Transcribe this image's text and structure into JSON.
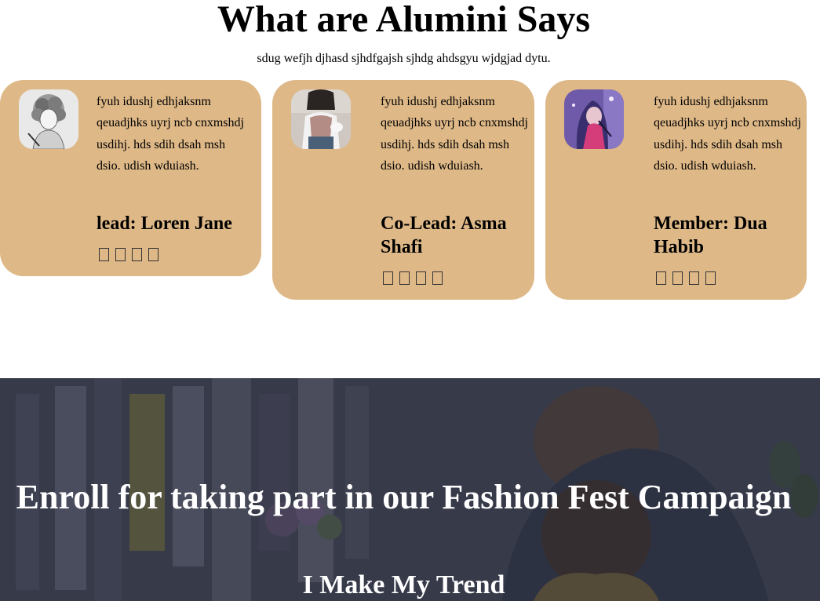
{
  "alumni_section": {
    "title": "What are Alumini Says",
    "subtitle": "sdug wefjh djhasd sjhdfgajsh sjhdg ahdsgyu wjdgjad dytu."
  },
  "cards": [
    {
      "text": "fyuh idushj edhjaksnm qeuadjhks uyrj ncb cnxmshdj usdihj. hds sdih dsah msh dsio. udish wduiash.",
      "name": "lead: Loren Jane",
      "stars": 4
    },
    {
      "text": "fyuh idushj edhjaksnm qeuadjhks uyrj ncb cnxmshdj usdihj. hds sdih dsah msh dsio. udish wduiash.",
      "name": "Co-Lead: Asma Shafi",
      "stars": 4
    },
    {
      "text": "fyuh idushj edhjaksnm qeuadjhks uyrj ncb cnxmshdj usdihj. hds sdih dsah msh dsio. udish wduiash.",
      "name": "Member: Dua Habib",
      "stars": 4
    }
  ],
  "banner": {
    "title": "Enroll for taking part in our Fashion Fest Campaign",
    "subtitle": "I Make My Trend"
  },
  "colors": {
    "card_bg": "#deb887",
    "banner_overlay": "#2c2f3d"
  },
  "icons": {
    "star": "star-icon (missing glyph box)"
  }
}
